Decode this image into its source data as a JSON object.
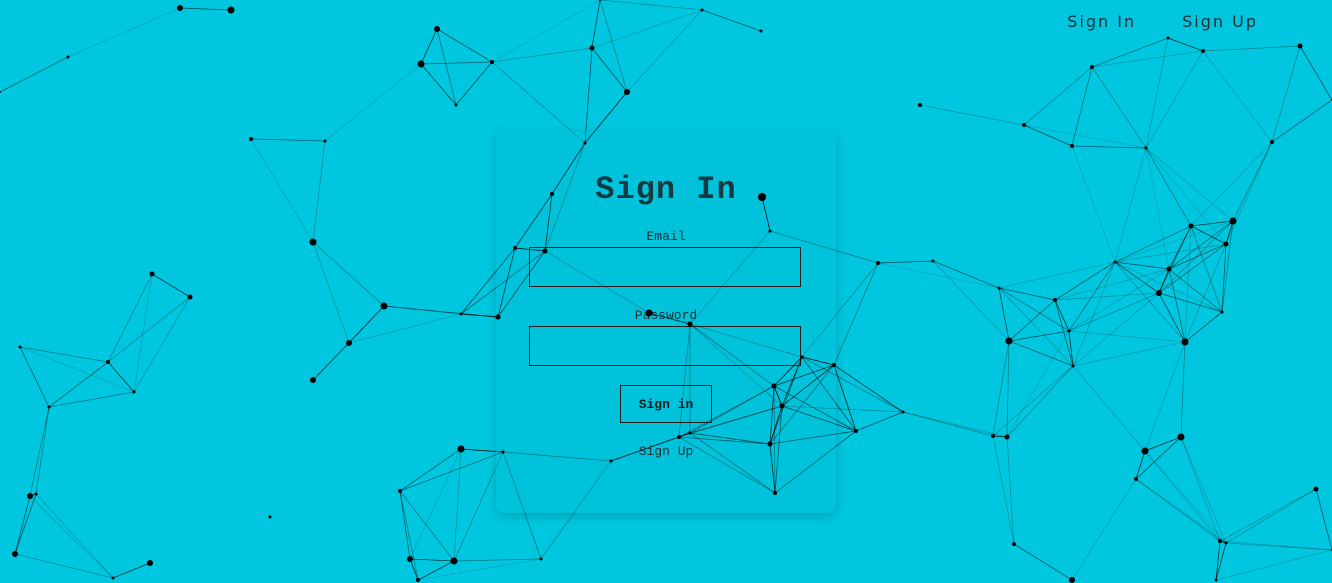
{
  "colors": {
    "background": "#00c7df",
    "network": "#000000"
  },
  "nav": {
    "sign_in": "Sign In",
    "sign_up": "Sign Up"
  },
  "form": {
    "title": "Sign In",
    "email_label": "Email",
    "email_value": "",
    "password_label": "Password",
    "password_value": "",
    "submit_label": "Sign in",
    "signup_link": "Sign Up"
  }
}
